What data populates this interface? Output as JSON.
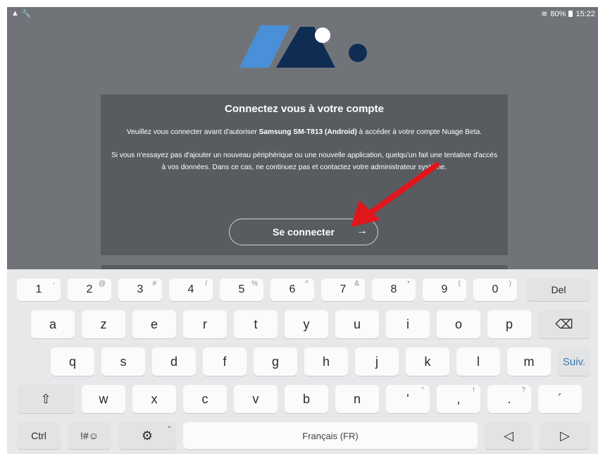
{
  "status_bar": {
    "left_icons": [
      "warning-icon",
      "wrench-icon"
    ],
    "battery": "80%",
    "time": "15:22"
  },
  "colors": {
    "background": "#707479",
    "dialog": "#585c61",
    "logo_light": "#4a90d9",
    "logo_dark": "#0f2d52",
    "annotation_arrow": "#e0161c"
  },
  "dialog": {
    "title": "Connectez vous à votre compte",
    "text1_before": "Veuillez vous connecter avant d'autoriser ",
    "text1_bold": "Samsung SM-T813 (Android)",
    "text1_after": " à accéder à votre compte Nuage Beta.",
    "text2": "Si vous n'essayez pas d'ajouter un nouveau périphérique ou une nouvelle application, quelqu'un fait une tentative d'accès à vos données. Dans ce cas, ne continuez pas et contactez votre administrateur système.",
    "connect_label": "Se connecter",
    "connect_arrow": "→"
  },
  "keyboard": {
    "number_row": [
      {
        "main": "1",
        "sup": "-"
      },
      {
        "main": "2",
        "sup": "@"
      },
      {
        "main": "3",
        "sup": "#"
      },
      {
        "main": "4",
        "sup": "/"
      },
      {
        "main": "5",
        "sup": "%"
      },
      {
        "main": "6",
        "sup": "^"
      },
      {
        "main": "7",
        "sup": "&"
      },
      {
        "main": "8",
        "sup": "*"
      },
      {
        "main": "9",
        "sup": "("
      },
      {
        "main": "0",
        "sup": ")"
      }
    ],
    "del_label": "Del",
    "row1": [
      "a",
      "z",
      "e",
      "r",
      "t",
      "y",
      "u",
      "i",
      "o",
      "p"
    ],
    "row2": [
      "q",
      "s",
      "d",
      "f",
      "g",
      "h",
      "j",
      "k",
      "l",
      "m"
    ],
    "next_label": "Suiv.",
    "row3": [
      "w",
      "x",
      "c",
      "v",
      "b",
      "n"
    ],
    "row3_punct": [
      {
        "main": "'",
        "sup": "\""
      },
      {
        "main": ",",
        "sup": "!"
      },
      {
        "main": ".",
        "sup": "?"
      },
      {
        "main": "´",
        "sup": ""
      }
    ],
    "ctrl_label": "Ctrl",
    "symbols_label": "!#☺",
    "space_label": "Français (FR)",
    "shift_glyph": "⇧",
    "backspace_glyph": "⌫",
    "settings_glyph": "⚙",
    "left_glyph": "◁",
    "right_glyph": "▷"
  }
}
